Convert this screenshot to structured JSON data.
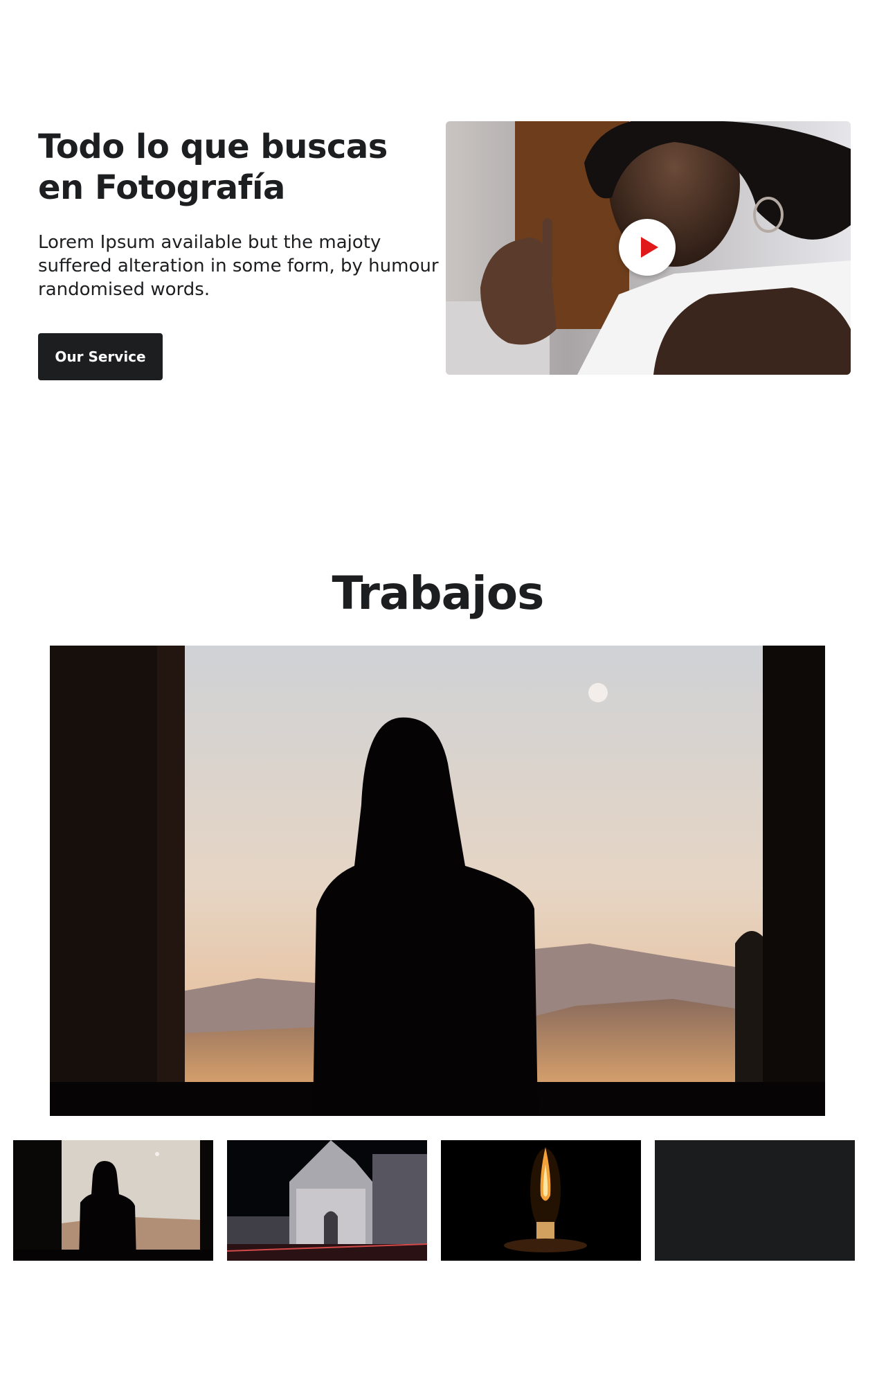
{
  "hero": {
    "title_line1": "Todo lo que buscas",
    "title_line2": "en Fotografía",
    "description": "Lorem Ipsum available but the majoty suffered alteration in some form, by humour randomised words.",
    "button_label": "Our Service"
  },
  "video": {
    "play_icon": "play-icon",
    "accent": "#e01a1a"
  },
  "works": {
    "title": "Trabajos",
    "thumbnails": [
      "woman-window-silhouette",
      "cathedral-night",
      "candle-flame",
      "dark-placeholder"
    ]
  },
  "colors": {
    "dark": "#1d1e20",
    "white": "#ffffff"
  }
}
